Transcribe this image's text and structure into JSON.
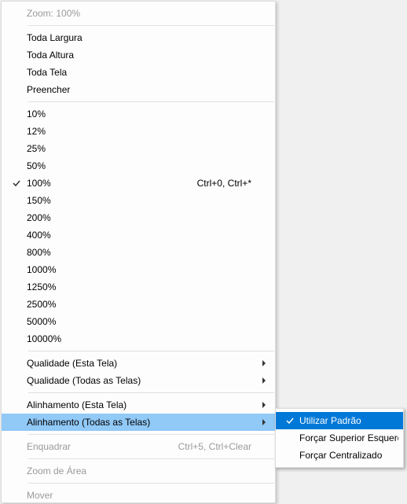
{
  "main_menu": {
    "header": "Zoom: 100%",
    "fit_modes": [
      "Toda Largura",
      "Toda Altura",
      "Toda Tela",
      "Preencher"
    ],
    "zoom_levels": [
      {
        "label": "10%",
        "checked": false,
        "shortcut": ""
      },
      {
        "label": "12%",
        "checked": false,
        "shortcut": ""
      },
      {
        "label": "25%",
        "checked": false,
        "shortcut": ""
      },
      {
        "label": "50%",
        "checked": false,
        "shortcut": ""
      },
      {
        "label": "100%",
        "checked": true,
        "shortcut": "Ctrl+0, Ctrl+*"
      },
      {
        "label": "150%",
        "checked": false,
        "shortcut": ""
      },
      {
        "label": "200%",
        "checked": false,
        "shortcut": ""
      },
      {
        "label": "400%",
        "checked": false,
        "shortcut": ""
      },
      {
        "label": "800%",
        "checked": false,
        "shortcut": ""
      },
      {
        "label": "1000%",
        "checked": false,
        "shortcut": ""
      },
      {
        "label": "1250%",
        "checked": false,
        "shortcut": ""
      },
      {
        "label": "2500%",
        "checked": false,
        "shortcut": ""
      },
      {
        "label": "5000%",
        "checked": false,
        "shortcut": ""
      },
      {
        "label": "10000%",
        "checked": false,
        "shortcut": ""
      }
    ],
    "quality": [
      "Qualidade (Esta Tela)",
      "Qualidade (Todas as Telas)"
    ],
    "alignment": [
      {
        "label": "Alinhamento (Esta Tela)",
        "highlighted": false
      },
      {
        "label": "Alinhamento (Todas as Telas)",
        "highlighted": true
      }
    ],
    "frame": {
      "label": "Enquadrar",
      "shortcut": "Ctrl+5, Ctrl+Clear"
    },
    "zoom_area": "Zoom de Área",
    "move": "Mover"
  },
  "submenu": {
    "items": [
      {
        "label": "Utilizar Padrão",
        "checked": true,
        "selected": true
      },
      {
        "label": "Forçar Superior Esquerdo",
        "checked": false,
        "selected": false
      },
      {
        "label": "Forçar Centralizado",
        "checked": false,
        "selected": false
      }
    ]
  }
}
